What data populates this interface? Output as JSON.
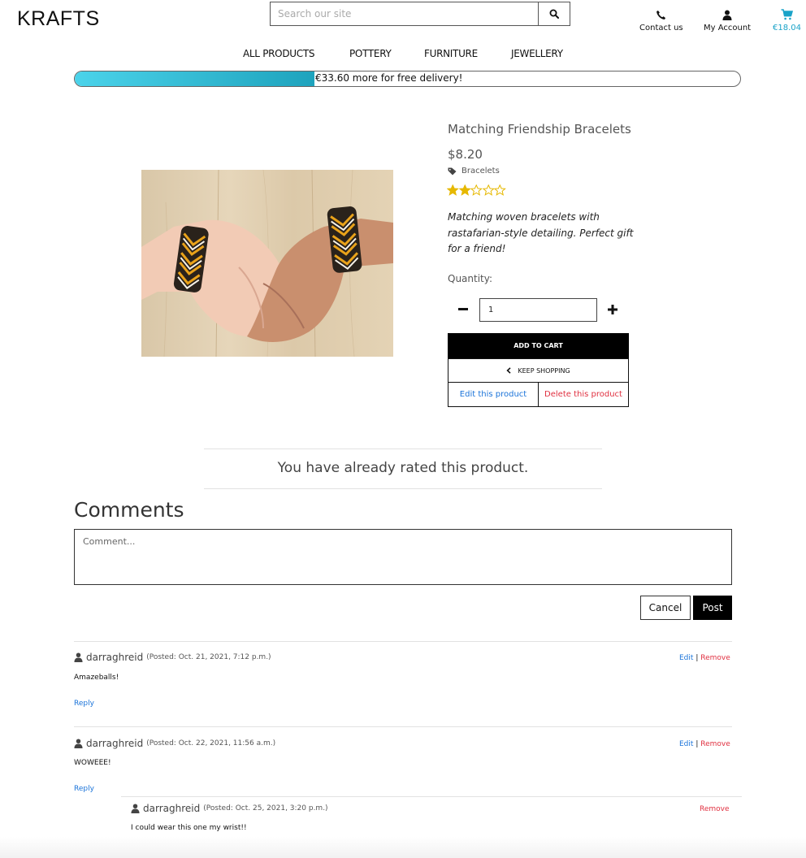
{
  "header": {
    "logo": "KRAFTS",
    "search_placeholder": "Search our site",
    "contact_label": "Contact us",
    "account_label": "My Account",
    "cart_total": "€18.04"
  },
  "nav": {
    "items": [
      "ALL PRODUCTS",
      "POTTERY",
      "FURNITURE",
      "JEWELLERY"
    ]
  },
  "delivery": {
    "text": "€33.60 more for free delivery!",
    "progress_percent": 36
  },
  "product": {
    "title": "Matching Friendship Bracelets",
    "price": "$8.20",
    "category": "Bracelets",
    "rating": 2,
    "rating_max": 5,
    "description": "Matching woven bracelets with rastafarian-style detailing. Perfect gift for a friend!",
    "quantity_label": "Quantity:",
    "quantity_value": "1",
    "add_to_cart": "ADD TO CART",
    "keep_shopping": "KEEP SHOPPING",
    "edit_label": "Edit this product",
    "delete_label": "Delete this product"
  },
  "rating_notice": "You have already rated this product.",
  "comments": {
    "heading": "Comments",
    "placeholder": "Comment...",
    "cancel_label": "Cancel",
    "post_label": "Post",
    "items": [
      {
        "user": "darraghreid",
        "posted": "(Posted: Oct. 21, 2021, 7:12 p.m.)",
        "body": "Amazeballs!",
        "reply": "Reply",
        "edit": "Edit",
        "sep": "|",
        "remove": "Remove"
      },
      {
        "user": "darraghreid",
        "posted": "(Posted: Oct. 22, 2021, 11:56 a.m.)",
        "body": "WOWEEE!",
        "reply": "Reply",
        "edit": "Edit",
        "sep": "|",
        "remove": "Remove"
      },
      {
        "user": "darraghreid",
        "posted": "(Posted: Oct. 25, 2021, 3:20 p.m.)",
        "body": "I could wear this one my wrist!!",
        "remove": "Remove"
      }
    ]
  },
  "colors": {
    "accent": "#1aa3c8",
    "link": "#1a73d9",
    "danger": "#e03040",
    "star": "#e6b800"
  }
}
